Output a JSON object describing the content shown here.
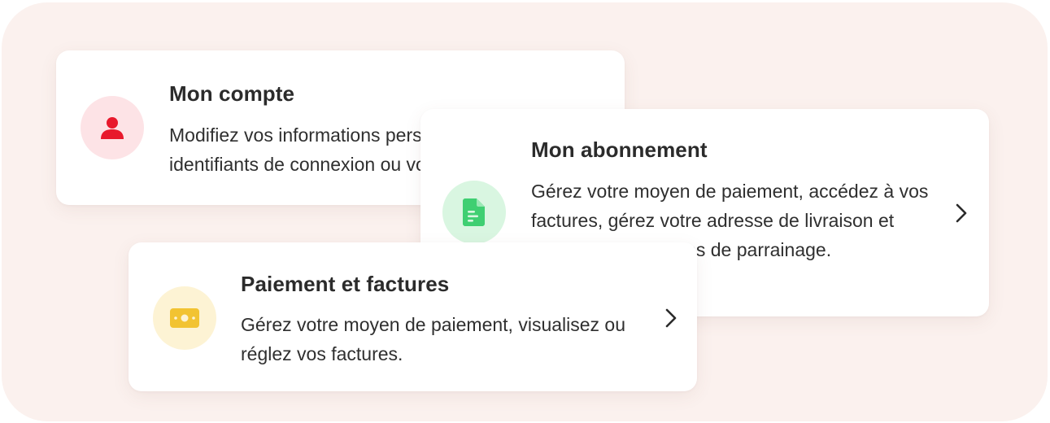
{
  "cards": [
    {
      "title": "Mon compte",
      "description": "Modifiez vos informations personnelles, vos identifiants de connexion ou votre mot de passe.",
      "icon": "person-icon",
      "icon_color": "#e8192c",
      "icon_bg": "#fde3e6"
    },
    {
      "title": "Mon abonnement",
      "description": "Gérez votre moyen de paiement, accédez à vos factures, gérez votre adresse de livraison et profitez de nos offres de parrainage.",
      "icon": "document-icon",
      "icon_color": "#3fcf72",
      "icon_bg": "#d9f6e1"
    },
    {
      "title": "Paiement et factures",
      "description": "Gérez votre moyen de paiement, visualisez ou réglez vos factures.",
      "icon": "banknote-icon",
      "icon_color": "#f2c332",
      "icon_bg": "#fdf3d4"
    }
  ],
  "colors": {
    "background": "#fbf1ee",
    "card": "#ffffff",
    "text": "#2b2b2b"
  }
}
